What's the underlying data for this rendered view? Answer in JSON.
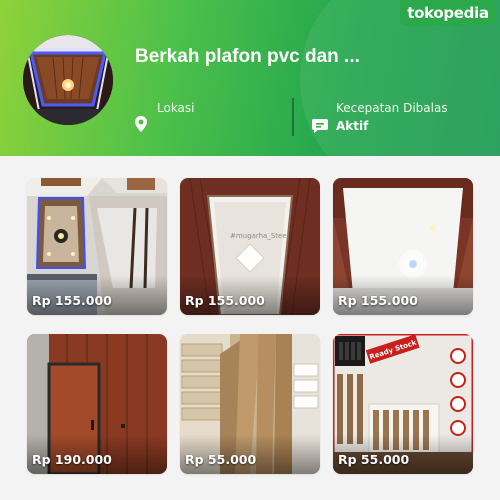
{
  "header": {
    "brand": "tokopedia",
    "shop_name": "Berkah plafon pvc dan ...",
    "location_label": "Lokasi",
    "location_value": "",
    "response_label": "Kecepatan Dibalas",
    "response_value": "Aktif",
    "colors": {
      "brand_green": "#42b549",
      "header_dark": "#1f9a55",
      "header_light": "#8fd23a"
    },
    "icons": [
      "location-pin-icon",
      "chat-bubble-icon"
    ]
  },
  "products": [
    {
      "price": "Rp 155.000"
    },
    {
      "price": "Rp 155.000"
    },
    {
      "price": "Rp 155.000"
    },
    {
      "price": "Rp 190.000"
    },
    {
      "price": "Rp 55.000"
    },
    {
      "price": "Rp 55.000"
    }
  ],
  "overlay_texts": {
    "watermark": "#mugarha_Steel",
    "ready_stock": "Ready Stock"
  }
}
